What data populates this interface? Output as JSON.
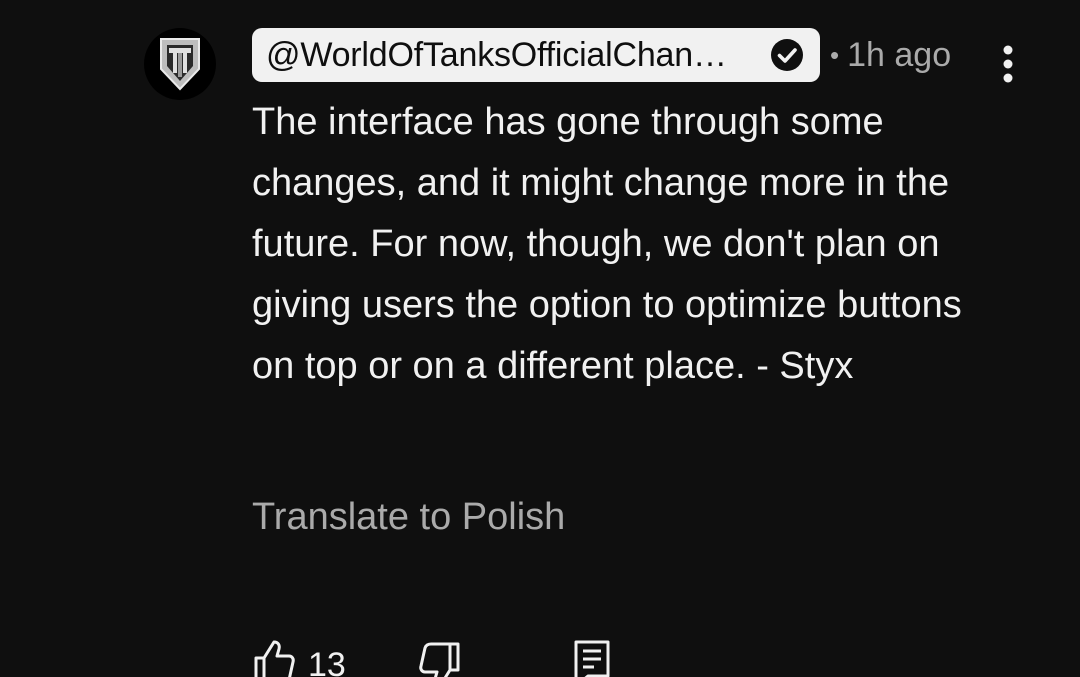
{
  "comment": {
    "author": "@WorldOfTanksOfficialChan…",
    "separator": "•",
    "timestamp": "1h ago",
    "text": "The interface has gone through some changes, and it might change more in the future. For now, though, we don't plan on giving users the option to optimize buttons on top or on a different place. - Styx",
    "translate_label": "Translate to Polish",
    "like_count": "13"
  },
  "icons": {
    "avatar": "world-of-tanks-logo",
    "verified": "check-circle-icon",
    "more": "vertical-dots-icon",
    "like": "thumbs-up-icon",
    "dislike": "thumbs-down-icon",
    "reply": "reply-comment-icon"
  },
  "colors": {
    "background": "#0f0f0f",
    "text_primary": "#f1f1f1",
    "text_secondary": "#aaaaaa",
    "author_chip_bg": "#f1f1f1"
  }
}
